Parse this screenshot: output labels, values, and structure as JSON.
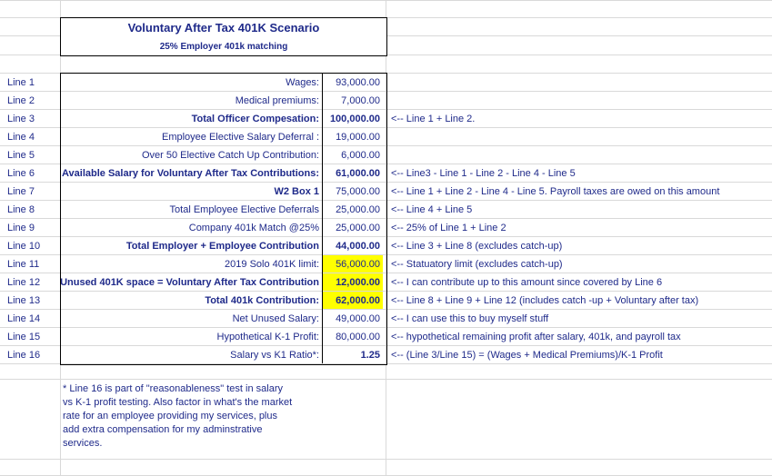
{
  "header": {
    "title": "Voluntary After Tax 401K Scenario",
    "subtitle": "25% Employer 401k matching"
  },
  "rows": [
    {
      "line": "Line 1",
      "label": "Wages:",
      "value": "93,000.00",
      "note": "",
      "bold": false,
      "highlight": false
    },
    {
      "line": "Line 2",
      "label": "Medical premiums:",
      "value": "7,000.00",
      "note": "",
      "bold": false,
      "highlight": false
    },
    {
      "line": "Line 3",
      "label": "Total Officer Compesation:",
      "value": "100,000.00",
      "note": "<-- Line 1 + Line 2.",
      "bold": true,
      "highlight": false
    },
    {
      "line": "Line 4",
      "label": "Employee Elective Salary Deferral :",
      "value": "19,000.00",
      "note": "",
      "bold": false,
      "highlight": false
    },
    {
      "line": "Line 5",
      "label": "Over 50 Elective Catch Up Contribution:",
      "value": "6,000.00",
      "note": "",
      "bold": false,
      "highlight": false
    },
    {
      "line": "Line 6",
      "label": "Available Salary for Voluntary After Tax Contributions:",
      "value": "61,000.00",
      "note": "<-- Line3 - Line 1 - Line 2 - Line 4 - Line 5",
      "bold": true,
      "highlight": false
    },
    {
      "line": "Line 7",
      "label": "W2 Box 1",
      "value": "75,000.00",
      "note": "<-- Line 1 + Line 2 - Line 4 - Line 5. Payroll taxes are owed on this amount",
      "bold": true,
      "highlight": false,
      "valueBold": false
    },
    {
      "line": "Line 8",
      "label": "Total Employee Elective Deferrals",
      "value": "25,000.00",
      "note": "<-- Line 4 + Line 5",
      "bold": false,
      "highlight": false
    },
    {
      "line": "Line 9",
      "label": "Company 401k Match @25%",
      "value": "25,000.00",
      "note": "<-- 25% of Line 1 + Line 2",
      "bold": false,
      "highlight": false
    },
    {
      "line": "Line 10",
      "label": "Total Employer + Employee Contribution",
      "value": "44,000.00",
      "note": "<-- Line 3 + Line 8 (excludes catch-up)",
      "bold": true,
      "highlight": false
    },
    {
      "line": "Line 11",
      "label": "2019 Solo 401K limit:",
      "value": "56,000.00",
      "note": "<-- Statuatory limit (excludes catch-up)",
      "bold": false,
      "highlight": true
    },
    {
      "line": "Line 12",
      "label": "Unused 401K space = Voluntary After Tax Contribution",
      "value": "12,000.00",
      "note": "<-- I can contribute up to this amount since covered by Line 6",
      "bold": true,
      "highlight": true
    },
    {
      "line": "Line 13",
      "label": "Total 401k Contribution:",
      "value": "62,000.00",
      "note": "<-- Line 8 + Line 9 + Line 12 (includes catch -up + Voluntary after tax)",
      "bold": true,
      "highlight": true
    },
    {
      "line": "Line 14",
      "label": "Net Unused Salary:",
      "value": "49,000.00",
      "note": "<-- I can use this to buy myself stuff",
      "bold": false,
      "highlight": false
    },
    {
      "line": "Line 15",
      "label": "Hypothetical K-1 Profit:",
      "value": "80,000.00",
      "note": "<-- hypothetical remaining profit after salary, 401k, and payroll tax",
      "bold": false,
      "highlight": false
    },
    {
      "line": "Line 16",
      "label": "Salary vs K1 Ratio*:",
      "value": "1.25",
      "note": "<-- (Line 3/Line 15) = (Wages + Medical Premiums)/K-1 Profit",
      "bold": false,
      "highlight": false,
      "valueBold": true
    }
  ],
  "footnote": [
    "* Line 16 is part of \"reasonableness\" test in salary",
    "vs K-1 profit testing. Also factor in what's the market",
    "rate for an employee providing my services, plus",
    "add  extra compensation for my adminstrative",
    "services."
  ]
}
